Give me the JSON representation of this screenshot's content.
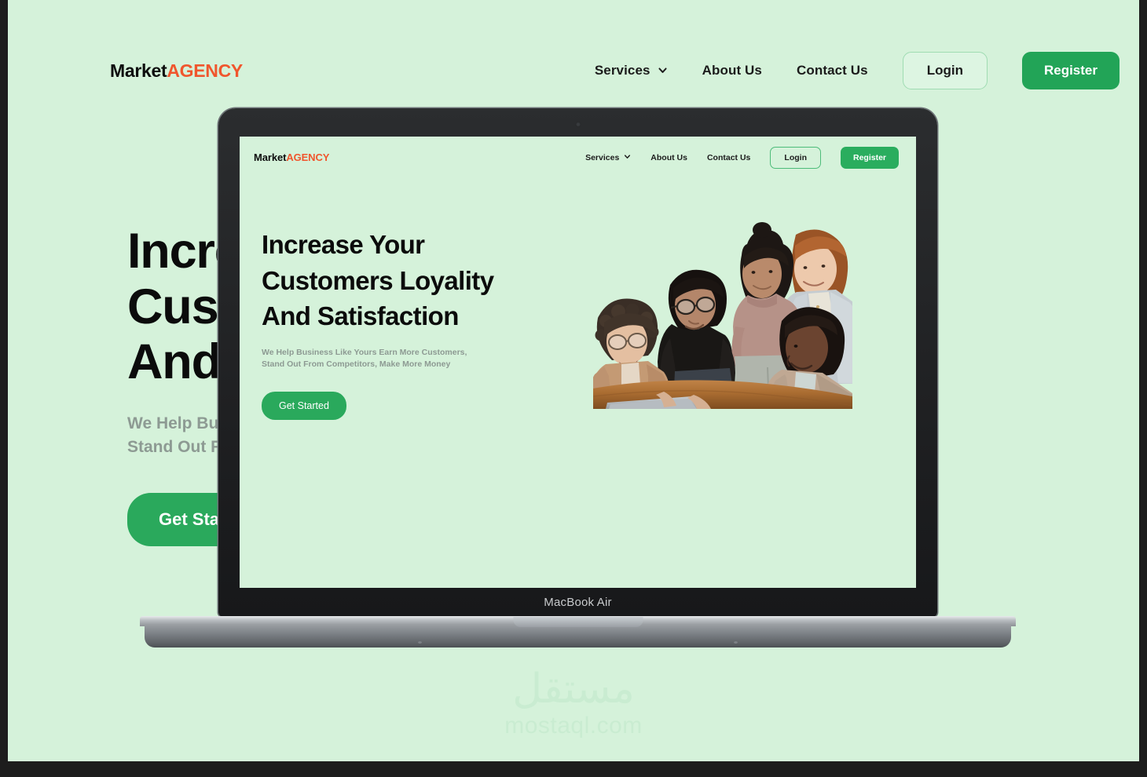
{
  "page": {
    "background_color": "#d5f2da",
    "frame_color": "#1d1d1d",
    "accent_green": "#2aa95c",
    "accent_orange": "#f0562d",
    "muted_text": "#8d9a93"
  },
  "background_site": {
    "logo": {
      "primary": "Market",
      "accent": "AGENCY"
    },
    "nav": [
      {
        "label": "Services",
        "icon": "chevron-down-icon",
        "has_dropdown": true
      },
      {
        "label": "About Us",
        "has_dropdown": false
      },
      {
        "label": "Contact Us",
        "has_dropdown": false
      }
    ],
    "login_label": "Login",
    "register_label": "Register",
    "hero": {
      "headline_line1": "Increase Your",
      "headline_line2": "Customers Loyality",
      "headline_line3": "And Satisfaction",
      "subtext_line1": "We Help Business Like Yours Earn More Customers,",
      "subtext_line2": "Stand Out From Competitors, Make More Money",
      "cta_label": "Get Started"
    }
  },
  "device": {
    "model_label": "MacBook Air",
    "camera": "webcam-dot"
  },
  "screen_site": {
    "logo": {
      "primary": "Market",
      "accent": "AGENCY"
    },
    "nav": [
      {
        "label": "Services",
        "icon": "chevron-down-icon",
        "has_dropdown": true
      },
      {
        "label": "About Us",
        "has_dropdown": false
      },
      {
        "label": "Contact Us",
        "has_dropdown": false
      }
    ],
    "login_label": "Login",
    "register_label": "Register",
    "hero": {
      "headline_line1": "Increase Your",
      "headline_line2": "Customers Loyality",
      "headline_line3": "And Satisfaction",
      "subtext_line1": "We Help Business Like Yours Earn More Customers,",
      "subtext_line2": "Stand Out From Competitors, Make More Money",
      "cta_label": "Get Started",
      "image_alt": "team-photo-five-people-around-laptop"
    }
  },
  "watermark": {
    "arabic": "مستقل",
    "latin": "mostaql.com",
    "color": "#c9ecd1"
  }
}
